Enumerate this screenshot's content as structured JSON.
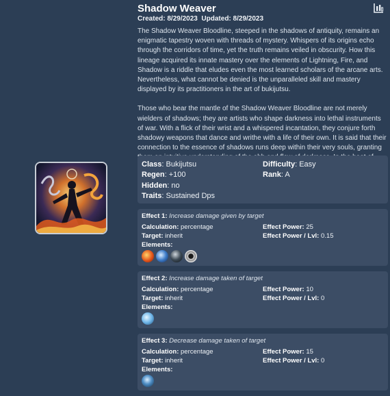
{
  "header": {
    "title": "Shadow Weaver",
    "created_label": "Created:",
    "created_value": "8/29/2023",
    "updated_label": "Updated:",
    "updated_value": "8/29/2023",
    "chart_icon": "bar-chart-icon"
  },
  "description": {
    "p1": "The Shadow Weaver Bloodline, steeped in the shadows of antiquity, remains an enigmatic tapestry woven with threads of mystery. Whispers of its origins echo through the corridors of time, yet the truth remains veiled in obscurity. How this lineage acquired its innate mastery over the elements of Lightning, Fire, and Shadow is a riddle that eludes even the most learned scholars of the arcane arts. Nevertheless, what cannot be denied is the unparalleled skill and mastery displayed by its practitioners in the art of bukijutsu.",
    "p2": "Those who bear the mantle of the Shadow Weaver Bloodline are not merely wielders of shadows; they are artists who shape darkness into lethal instruments of war. With a flick of their wrist and a whispered incantation, they conjure forth shadowy weapons that dance and writhe with a life of their own. It is said that their connection to the essence of shadows runs deep within their very souls, granting them an intuitive understanding of the ebb and flow of darkness. In the heat of battle, they are a sight to behold, weaving shadows into a deadly symphony that strikes fear into the hearts of their foes."
  },
  "stats": {
    "class_label": "Class",
    "class_value": "Bukijutsu",
    "difficulty_label": "Difficulty",
    "difficulty_value": "Easy",
    "regen_label": "Regen",
    "regen_value": "+100",
    "rank_label": "Rank",
    "rank_value": "A",
    "hidden_label": "Hidden",
    "hidden_value": "no",
    "traits_label": "Traits",
    "traits_value": "Sustained Dps"
  },
  "effects": [
    {
      "label": "Effect 1:",
      "name": "Increase damage given by target",
      "calc_label": "Calculation:",
      "calc_value": "percentage",
      "target_label": "Target:",
      "target_value": "inherit",
      "power_label": "Effect Power:",
      "power_value": "25",
      "lvl_label": "Effect Power / Lvl:",
      "lvl_value": "0.15",
      "elements_label": "Elements:",
      "elements": [
        "fire-orb-icon",
        "lightning-orb-icon",
        "shadow-orb-icon",
        "void-ring-icon"
      ]
    },
    {
      "label": "Effect 2:",
      "name": "Increase damage taken of target",
      "calc_label": "Calculation:",
      "calc_value": "percentage",
      "target_label": "Target:",
      "target_value": "inherit",
      "power_label": "Effect Power:",
      "power_value": "10",
      "lvl_label": "Effect Power / Lvl:",
      "lvl_value": "0",
      "elements_label": "Elements:",
      "elements": [
        "ice-orb-icon"
      ]
    },
    {
      "label": "Effect 3:",
      "name": "Decrease damage taken of target",
      "calc_label": "Calculation:",
      "calc_value": "percentage",
      "target_label": "Target:",
      "target_value": "inherit",
      "power_label": "Effect Power:",
      "power_value": "15",
      "lvl_label": "Effect Power / Lvl:",
      "lvl_value": "0",
      "elements_label": "Elements:",
      "elements": [
        "water-orb-icon"
      ]
    }
  ],
  "colors": {
    "background": "#2c3e55",
    "panel": "#3c4d65"
  }
}
